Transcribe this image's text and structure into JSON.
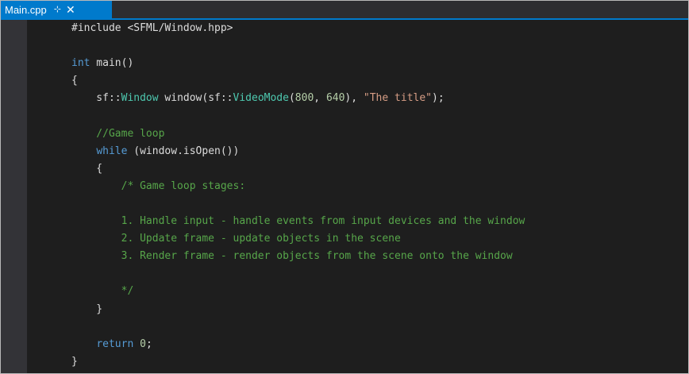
{
  "tab": {
    "filename": "Main.cpp",
    "pin_glyph": "⊹",
    "close_glyph": "✕"
  },
  "code_lines": [
    [
      {
        "t": "#include <SFML/Window.hpp>",
        "c": "pl"
      }
    ],
    [],
    [
      {
        "t": "int",
        "c": "kw"
      },
      {
        "t": " main()",
        "c": "pl"
      }
    ],
    [
      {
        "t": "{",
        "c": "pl"
      }
    ],
    [
      {
        "t": "    sf::",
        "c": "pl"
      },
      {
        "t": "Window",
        "c": "ty"
      },
      {
        "t": " window(sf::",
        "c": "pl"
      },
      {
        "t": "VideoMode",
        "c": "ty"
      },
      {
        "t": "(",
        "c": "pl"
      },
      {
        "t": "800",
        "c": "num"
      },
      {
        "t": ", ",
        "c": "pl"
      },
      {
        "t": "640",
        "c": "num"
      },
      {
        "t": "), ",
        "c": "pl"
      },
      {
        "t": "\"The title\"",
        "c": "str"
      },
      {
        "t": ");",
        "c": "pl"
      }
    ],
    [],
    [
      {
        "t": "    //Game loop",
        "c": "cm"
      }
    ],
    [
      {
        "t": "    ",
        "c": "pl"
      },
      {
        "t": "while",
        "c": "kw"
      },
      {
        "t": " (window.isOpen())",
        "c": "pl"
      }
    ],
    [
      {
        "t": "    {",
        "c": "pl"
      }
    ],
    [
      {
        "t": "        /* Game loop stages:",
        "c": "cm"
      }
    ],
    [],
    [
      {
        "t": "        1. Handle input - handle events from input devices and the window",
        "c": "cm"
      }
    ],
    [
      {
        "t": "        2. Update frame - update objects in the scene",
        "c": "cm"
      }
    ],
    [
      {
        "t": "        3. Render frame - render objects from the scene onto the window",
        "c": "cm"
      }
    ],
    [],
    [
      {
        "t": "        */",
        "c": "cm"
      }
    ],
    [
      {
        "t": "    }",
        "c": "pl"
      }
    ],
    [],
    [
      {
        "t": "    ",
        "c": "pl"
      },
      {
        "t": "return",
        "c": "kw"
      },
      {
        "t": " ",
        "c": "pl"
      },
      {
        "t": "0",
        "c": "num"
      },
      {
        "t": ";",
        "c": "pl"
      }
    ],
    [
      {
        "t": "}",
        "c": "pl"
      }
    ]
  ]
}
